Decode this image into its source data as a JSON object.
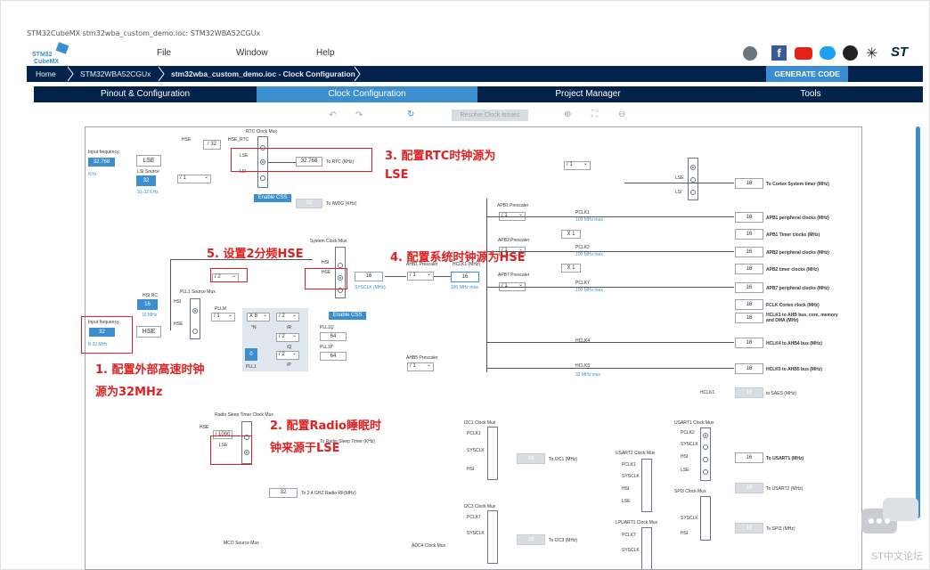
{
  "window": {
    "title": "STM32CubeMX stm32wba_custom_demo.ioc: STM32WBA52CGUx"
  },
  "menu": {
    "file": "File",
    "window": "Window",
    "help": "Help"
  },
  "logo": {
    "line1": "STM32",
    "line2": "CubeMX"
  },
  "breadcrumb": {
    "home": "Home",
    "mcu": "STM32WBA52CGUx",
    "project": "stm32wba_custom_demo.ioc - Clock Configuration"
  },
  "generate_code": "GENERATE CODE",
  "tabs": [
    "Pinout & Configuration",
    "Clock Configuration",
    "Project Manager",
    "Tools"
  ],
  "toolbar": {
    "resolve": "Resolve Clock Issues"
  },
  "clock": {
    "input_freq_label": "Input frequency",
    "lse_value": "32.768",
    "lse": "LSE",
    "lse_unit": "KHz",
    "lsi_source": "LSI Source",
    "lsi_value": "32",
    "lsi_range": "31-32 KHz",
    "hsi_rc": "HSI RC",
    "hsi_value": "16",
    "hsi_unit": "16 MHz",
    "hse_input": "32",
    "hse": "HSE",
    "hse_range": "8-32 MHz",
    "rtc_mux": "RTC Clock Mux",
    "hse_label": "HSE",
    "div32": "/ 32",
    "hse_rtc": "HSE_RTC",
    "lsi": "LSI",
    "rtc_value": "32.768",
    "to_rtc": "To RTC (KHz)",
    "enable_css": "Enable CSS",
    "iwdg_value": "32",
    "to_iwdg": "To IWDG (KHz)",
    "div1": "/ 1",
    "div2": "/ 2",
    "sys_mux": "System Clock Mux",
    "sysclk_value": "16",
    "sysclk_label": "SYSCLK (MHz)",
    "pll_src": "PLL1 Source Mux",
    "pllm": "PLLM",
    "x8": "X 8",
    "n": "*N",
    "r": "/R",
    "q": "/Q",
    "p": "/P",
    "pll1q": "PLL1Q",
    "pll1p": "PLL1P",
    "pll_out_q": "64",
    "pll_out_p": "64",
    "pll1": "PLL1",
    "pll_val": "0",
    "ahb1": "AHB1 Prescaler",
    "hclk1": "HCLK1 (MHz)",
    "hclk1_value": "16",
    "hclk_max": "100 MHz max",
    "apb1": "APB1 Prescaler",
    "apb2": "APB2 Prescaler",
    "apb7": "APB7 Prescaler",
    "ahb5": "AHB5 Prescaler",
    "pclk1": "PCLK1",
    "pclk2": "PCLK2",
    "pclk7": "PCLK7",
    "hclk4": "HCLK4",
    "hclk5": "HCLK5",
    "hclk1_lbl": "HCLK1",
    "max100": "100 MHz max",
    "max32": "32 MHz max",
    "x1": "X 1",
    "outputs": [
      {
        "value": "16",
        "label": "To Cortex System timer (MHz)"
      },
      {
        "value": "16",
        "label": "APB1 peripheral clocks (MHz)"
      },
      {
        "value": "16",
        "label": "APB1 Timer clocks (MHz)"
      },
      {
        "value": "16",
        "label": "APB2 peripheral clocks (MHz)"
      },
      {
        "value": "16",
        "label": "APB2 timer clocks (MHz)"
      },
      {
        "value": "16",
        "label": "APB7 peripheral clocks (MHz)"
      },
      {
        "value": "16",
        "label": "FCLK Cortex clock (MHz)"
      },
      {
        "value": "16",
        "label": "HCLK1 to AHB bus, core, memory and DMA (MHz)"
      },
      {
        "value": "16",
        "label": "HCLK4 to AHB4 bus (MHz)"
      },
      {
        "value": "16",
        "label": "HCLK5 to AHB5 bus (MHz)"
      }
    ],
    "sai_value": "16",
    "to_sai": "to SAES (MHz)",
    "radio_mux": "Radio Sleep Timer Clock Mux",
    "div1000": "/ 1000",
    "radio_to": "To Radio Sleep Timer (KHz)",
    "radio_rf_value": "32",
    "radio_rf": "To 2.4 GHZ Radio RF(MHz)",
    "i2c1": "I2C1 Clock Mux",
    "i2c3": "I2C3 Clock Mux",
    "usart1": "USART1 Clock Mux",
    "usart2": "USART2 Clock Mux",
    "lpuart1": "LPUART1 Clock Mux",
    "spi3": "SPI3 Clock Mux",
    "adc4": "ADC4 Clock Mux",
    "mco": "MCO Source Mux",
    "pclk1_in": "PCLK1",
    "pclk2_in": "PCLK2",
    "pclk7_in": "PCLK7",
    "sysclk_in": "SYSCLK",
    "hsi_in": "HSI",
    "lse_in": "LSE",
    "to_i2c1": "To I2C1 (MHz)",
    "to_i2c3": "To I2C3 (MHz)",
    "to_usart1": "To USART1 (MHz)",
    "to_usart2": "To USART2 (MHz)",
    "to_spi3": "To SPI3 (MHz)",
    "usart1_value": "16"
  },
  "annotations": {
    "a1_line1": "1. 配置外部高速时钟",
    "a1_line2": "源为32MHz",
    "a2_line1": "2. 配置Radio睡眠时",
    "a2_line2": "钟来源于LSE",
    "a3_line1": "3. 配置RTC时钟源为",
    "a3_line2": "LSE",
    "a4": "4. 配置系统时钟源为HSE",
    "a5": "5. 设置2分频HSE"
  },
  "watermark": "ST中文论坛",
  "colors": {
    "nav": "#03234b",
    "accent": "#3b8fd1",
    "annotation": "#e02020"
  }
}
